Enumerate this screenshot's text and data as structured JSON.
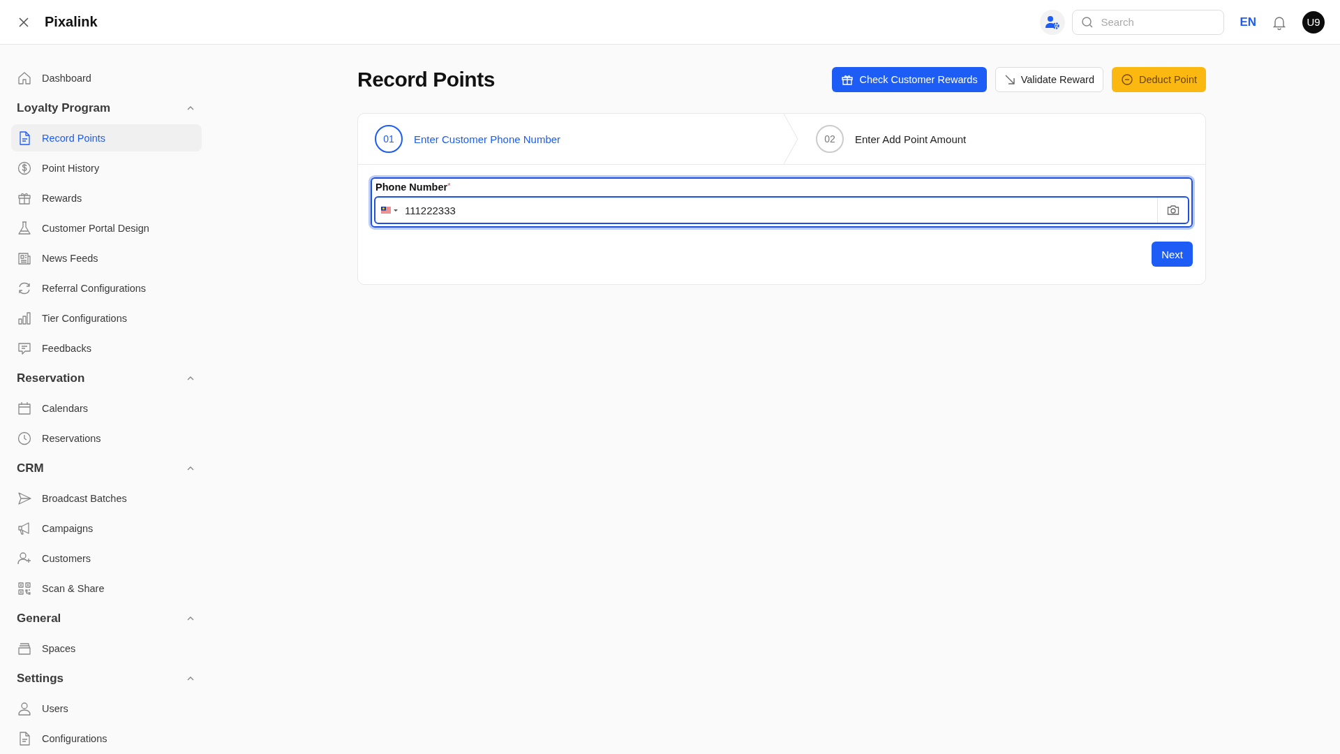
{
  "header": {
    "brand": "Pixalink",
    "search": {
      "placeholder": "Search"
    },
    "language": {
      "label": "EN",
      "selected": true
    },
    "avatar": "U9"
  },
  "sidebar": [
    {
      "kind": "link",
      "label": "Dashboard",
      "selected": false
    },
    {
      "kind": "section",
      "label": "Loyalty Program",
      "expanded": true,
      "children": [
        {
          "label": "Record Points",
          "selected": true
        },
        {
          "label": "Point History",
          "selected": false
        },
        {
          "label": "Rewards",
          "selected": false
        },
        {
          "label": "Customer Portal Design",
          "selected": false
        },
        {
          "label": "News Feeds",
          "selected": false
        },
        {
          "label": "Referral Configurations",
          "selected": false
        },
        {
          "label": "Tier Configurations",
          "selected": false
        },
        {
          "label": "Feedbacks",
          "selected": false
        }
      ]
    },
    {
      "kind": "section",
      "label": "Reservation",
      "expanded": true,
      "children": [
        {
          "label": "Calendars",
          "selected": false
        },
        {
          "label": "Reservations",
          "selected": false
        }
      ]
    },
    {
      "kind": "section",
      "label": "CRM",
      "expanded": true,
      "children": [
        {
          "label": "Broadcast Batches",
          "selected": false
        },
        {
          "label": "Campaigns",
          "selected": false
        },
        {
          "label": "Customers",
          "selected": false
        },
        {
          "label": "Scan & Share",
          "selected": false
        }
      ]
    },
    {
      "kind": "section",
      "label": "General",
      "expanded": true,
      "children": [
        {
          "label": "Spaces",
          "selected": false
        }
      ]
    },
    {
      "kind": "section",
      "label": "Settings",
      "expanded": true,
      "children": [
        {
          "label": "Users",
          "selected": false
        },
        {
          "label": "Configurations",
          "selected": false
        }
      ]
    }
  ],
  "page": {
    "title": "Record Points",
    "actions": [
      {
        "label": "Check Customer Rewards",
        "kind": "primary"
      },
      {
        "label": "Validate Reward",
        "kind": "outline"
      },
      {
        "label": "Deduct Point",
        "kind": "warning"
      }
    ],
    "steps": [
      {
        "number": "01",
        "label": "Enter Customer Phone Number",
        "selected": true
      },
      {
        "number": "02",
        "label": "Enter Add Point Amount",
        "selected": false
      }
    ],
    "field": {
      "label": "Phone Number",
      "required_mark": "*",
      "value": "111222333",
      "focused": true
    },
    "next": "Next"
  }
}
